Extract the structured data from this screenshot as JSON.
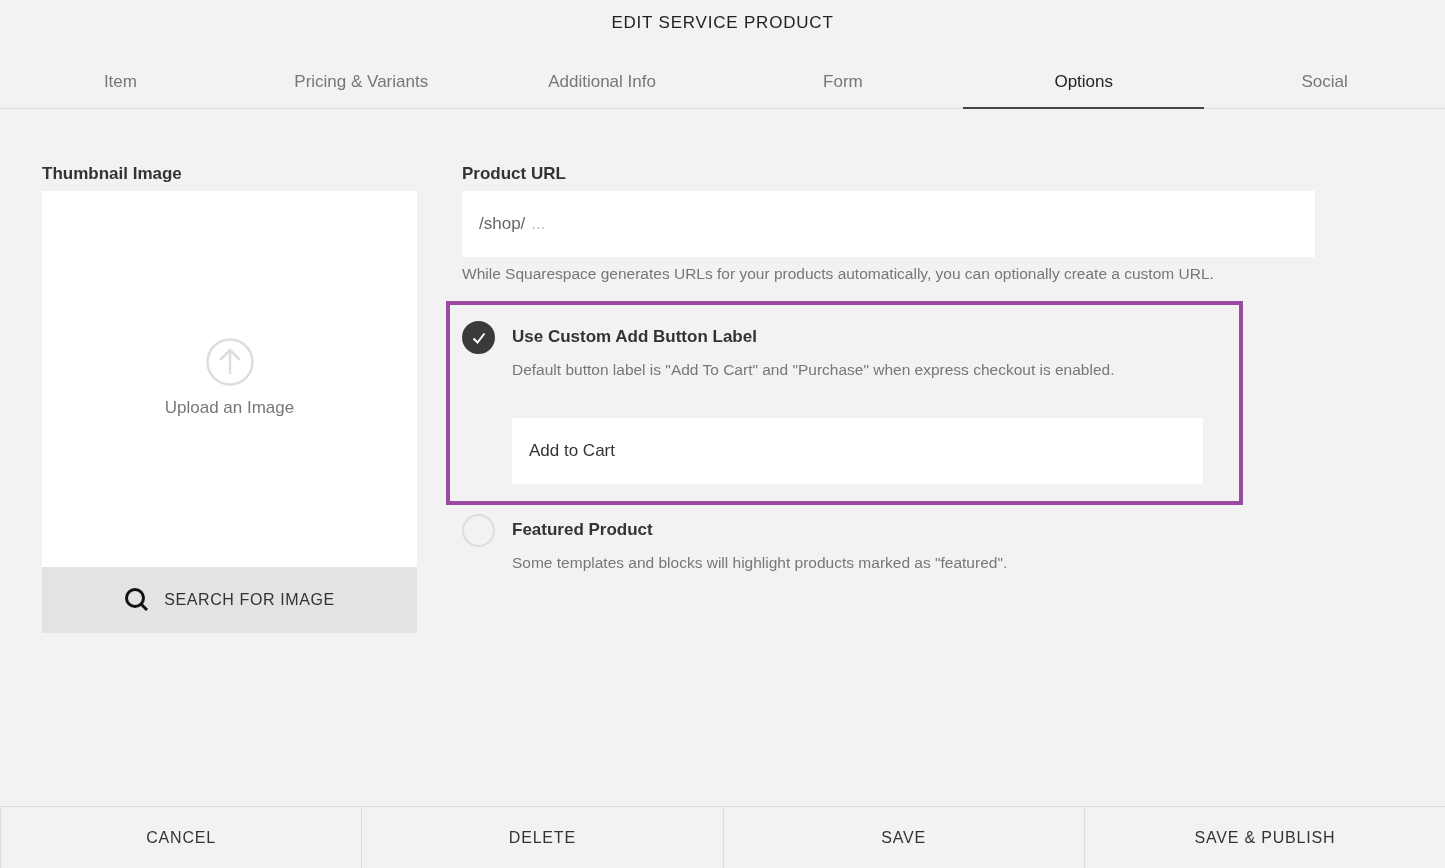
{
  "window": {
    "title": "EDIT SERVICE PRODUCT"
  },
  "tabs": [
    {
      "label": "Item",
      "selected": false
    },
    {
      "label": "Pricing & Variants",
      "selected": false
    },
    {
      "label": "Additional Info",
      "selected": false
    },
    {
      "label": "Form",
      "selected": false
    },
    {
      "label": "Options",
      "selected": true
    },
    {
      "label": "Social",
      "selected": false
    }
  ],
  "thumbnail": {
    "label": "Thumbnail Image",
    "upload_text": "Upload an Image",
    "search_button": "SEARCH FOR IMAGE"
  },
  "product_url": {
    "label": "Product URL",
    "prefix": "/shop/",
    "placeholder": "...",
    "help": "While Squarespace generates URLs for your products automatically, you can optionally create a custom URL."
  },
  "options": [
    {
      "label": "Use Custom Add Button Label",
      "description": "Default button label is \"Add To Cart\" and \"Purchase\" when express checkout is enabled.",
      "checked": true,
      "highlighted": true,
      "field_value": "Add to Cart"
    },
    {
      "label": "Featured Product",
      "description": "Some templates and blocks will highlight products marked as \"featured\".",
      "checked": false,
      "highlighted": false
    }
  ],
  "footer_buttons": [
    "CANCEL",
    "DELETE",
    "SAVE",
    "SAVE & PUBLISH"
  ]
}
